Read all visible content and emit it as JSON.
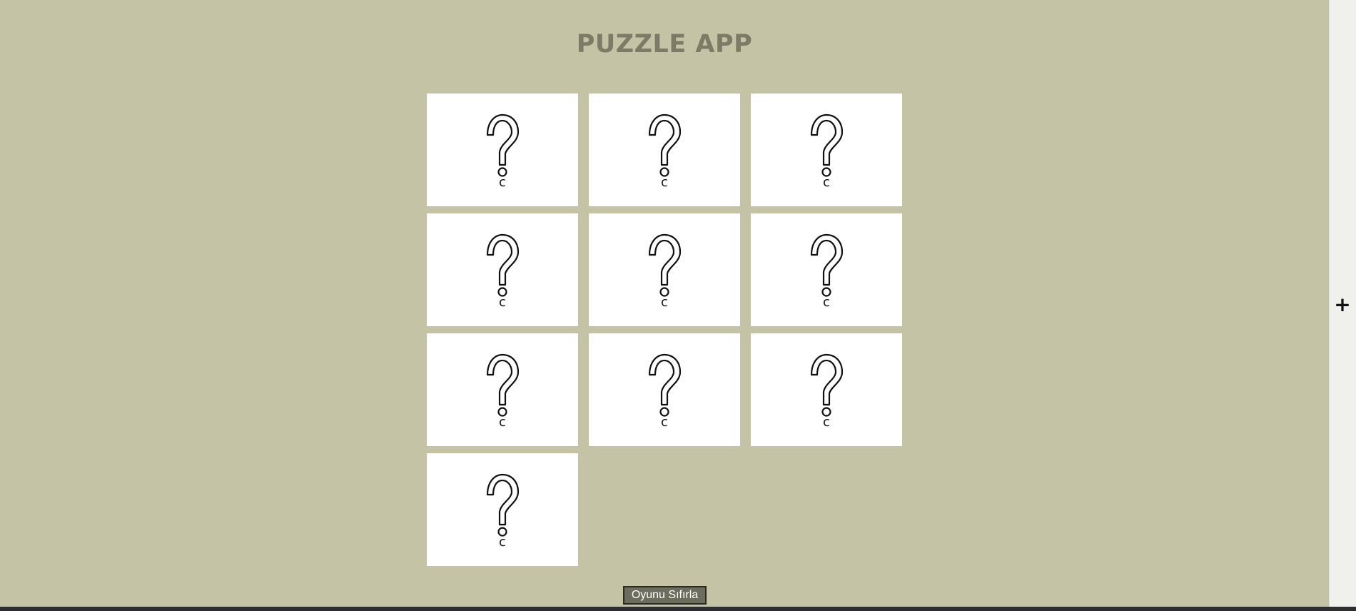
{
  "app": {
    "title": "PUZZLE APP",
    "background_color": "#c4c3a5",
    "title_color": "#7b7b66"
  },
  "cards": [
    {
      "label": "c",
      "icon": "question-mark-icon"
    },
    {
      "label": "c",
      "icon": "question-mark-icon"
    },
    {
      "label": "c",
      "icon": "question-mark-icon"
    },
    {
      "label": "c",
      "icon": "question-mark-icon"
    },
    {
      "label": "c",
      "icon": "question-mark-icon"
    },
    {
      "label": "c",
      "icon": "question-mark-icon"
    },
    {
      "label": "c",
      "icon": "question-mark-icon"
    },
    {
      "label": "c",
      "icon": "question-mark-icon"
    },
    {
      "label": "c",
      "icon": "question-mark-icon"
    },
    {
      "label": "c",
      "icon": "question-mark-icon"
    }
  ],
  "controls": {
    "reset_label": "Oyunu Sıfırla",
    "reset_bg": "#6d6d5e"
  },
  "side_panel": {
    "expand_icon": "plus-icon",
    "expand_label": "+"
  }
}
